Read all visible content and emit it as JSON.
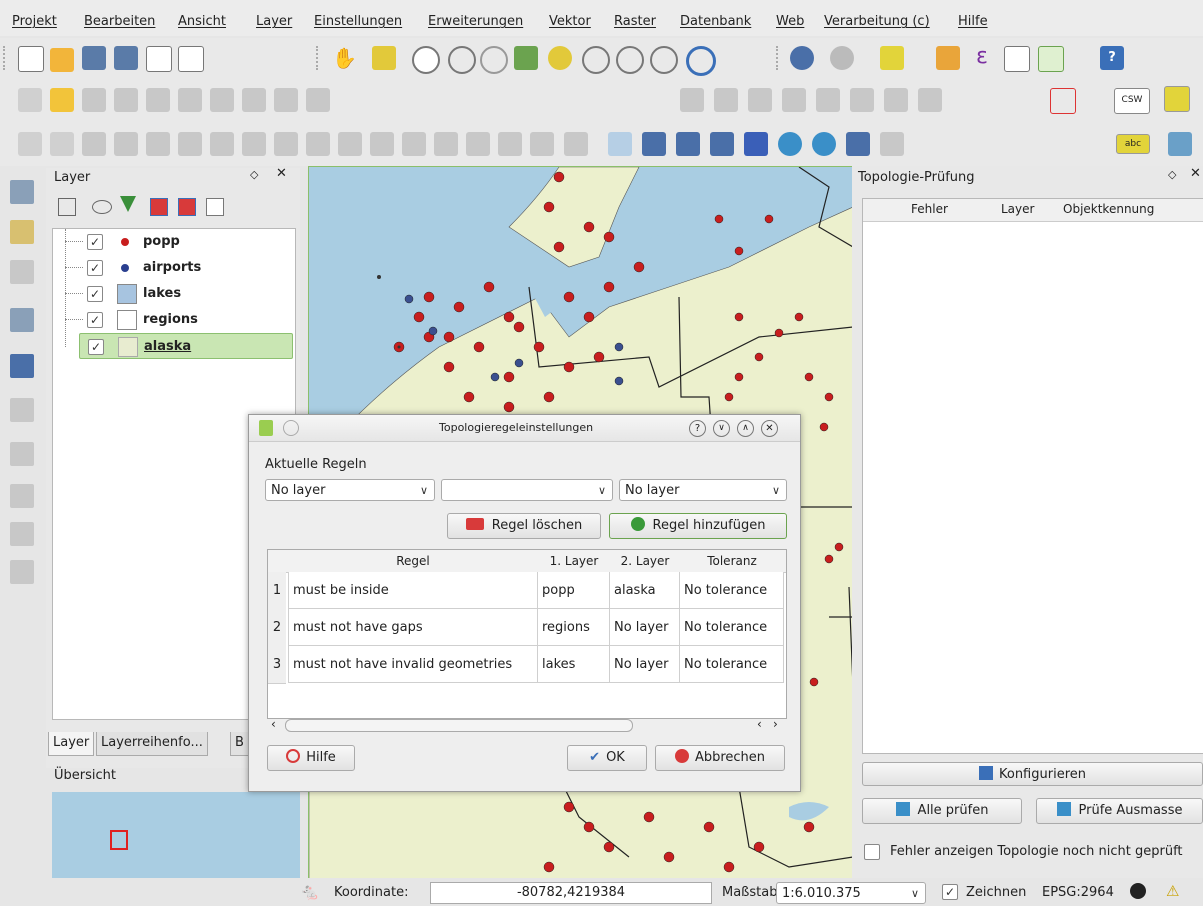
{
  "menubar": {
    "items": [
      "Projekt",
      "Bearbeiten",
      "Ansicht",
      "Layer",
      "Einstellungen",
      "Erweiterungen",
      "Vektor",
      "Raster",
      "Datenbank",
      "Web",
      "Verarbeitung (c)",
      "Hilfe"
    ]
  },
  "toolbar": {
    "icon_names": [
      "new-project-icon",
      "open-project-icon",
      "save-project-icon",
      "save-as-icon",
      "new-print-composer-icon",
      "composer-manager-icon",
      "pan-icon",
      "pan-to-selection-icon",
      "zoom-in-icon",
      "zoom-out-icon",
      "zoom-native-icon",
      "zoom-full-icon",
      "zoom-to-selection-icon",
      "zoom-to-layer-icon",
      "zoom-last-icon",
      "zoom-next-icon",
      "refresh-icon",
      "identify-icon",
      "select-features-icon",
      "deselect-icon",
      "expression-icon",
      "attribute-table-icon",
      "statistics-icon",
      "help-icon"
    ],
    "csw_label": "CSW",
    "abc_label": "abc"
  },
  "layer_panel": {
    "title": "Layer",
    "layers": [
      {
        "name": "popp",
        "symbol": "point",
        "color": "#c81e1e"
      },
      {
        "name": "airports",
        "symbol": "point",
        "color": "#2a3f8f"
      },
      {
        "name": "lakes",
        "symbol": "fill",
        "color": "#a7c4e0"
      },
      {
        "name": "regions",
        "symbol": "fill",
        "color": "#ffffff"
      },
      {
        "name": "alaska",
        "symbol": "fill",
        "color": "#e8ecd0"
      }
    ],
    "tabs": [
      "Layer",
      "Layerreihenfo...",
      "B"
    ],
    "overview_title": "Übersicht"
  },
  "topology_panel": {
    "title": "Topologie-Prüfung",
    "columns": [
      "Fehler",
      "Layer",
      "Objektkennung"
    ],
    "configure_label": "Konfigurieren",
    "check_all_label": "Alle prüfen",
    "check_extent_label": "Prüfe Ausmasse",
    "show_errors_label": "Fehler anzeigen Topologie noch nicht geprüft"
  },
  "dialog": {
    "title": "Topologieregeleinstellungen",
    "current_rules_label": "Aktuelle Regeln",
    "combo_layer1": "No layer",
    "combo_rule": "",
    "combo_layer2": "No layer",
    "delete_rule_label": "Regel löschen",
    "add_rule_label": "Regel hinzufügen",
    "columns": [
      "Regel",
      "1. Layer",
      "2. Layer",
      "Toleranz"
    ],
    "rows": [
      {
        "num": "1",
        "rule": "must be inside",
        "layer1": "popp",
        "layer2": "alaska",
        "tolerance": "No tolerance"
      },
      {
        "num": "2",
        "rule": "must not have gaps",
        "layer1": "regions",
        "layer2": "No layer",
        "tolerance": "No tolerance"
      },
      {
        "num": "3",
        "rule": "must not have invalid geometries",
        "layer1": "lakes",
        "layer2": "No layer",
        "tolerance": "No tolerance"
      }
    ],
    "help_label": "Hilfe",
    "ok_label": "OK",
    "cancel_label": "Abbrechen"
  },
  "statusbar": {
    "coord_label": "Koordinate:",
    "coord_value": "-80782,4219384",
    "scale_label": "Maßstab",
    "scale_value": "1:6.010.375",
    "render_label": "Zeichnen",
    "crs": "EPSG:2964"
  },
  "colors": {
    "land": "#ecf0cd",
    "water": "#a9cde2",
    "point_popp": "#c81e1e",
    "point_airport": "#3a4f8f",
    "accent_green": "#6ba34f"
  }
}
